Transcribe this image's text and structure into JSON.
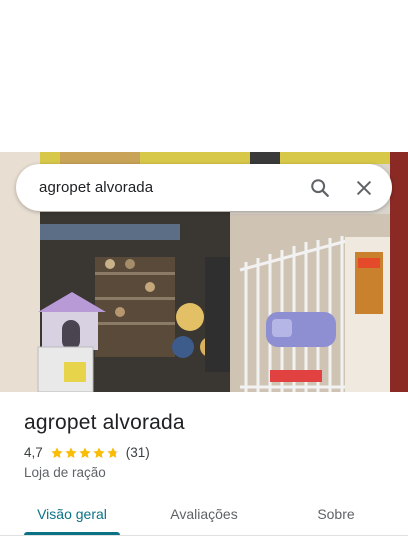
{
  "search": {
    "query": "agropet alvorada",
    "search_icon": "search-icon",
    "clear_icon": "close-icon"
  },
  "place": {
    "name": "agropet alvorada",
    "rating": "4,7",
    "rating_value": 4.7,
    "review_count": "(31)",
    "category": "Loja de ração",
    "star_color": "#fbbc04"
  },
  "tabs": [
    {
      "label": "Visão geral",
      "active": true
    },
    {
      "label": "Avaliações",
      "active": false
    },
    {
      "label": "Sobre",
      "active": false
    }
  ],
  "colors": {
    "accent": "#0b7285"
  }
}
